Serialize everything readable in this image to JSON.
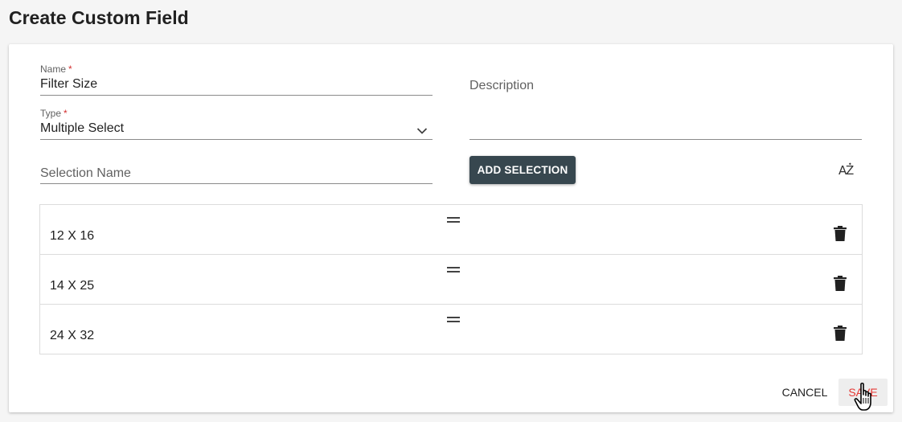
{
  "page": {
    "title": "Create Custom Field"
  },
  "form": {
    "name": {
      "label": "Name",
      "required_mark": "*",
      "value": "Filter Size"
    },
    "type": {
      "label": "Type",
      "required_mark": "*",
      "value": "Multiple Select"
    },
    "description": {
      "placeholder": "Description",
      "value": ""
    },
    "selection_name": {
      "placeholder": "Selection Name",
      "value": ""
    }
  },
  "actions": {
    "add_selection_label": "ADD SELECTION",
    "sort_icon": "sort-alphabetical-icon",
    "cancel_label": "CANCEL",
    "save_label": "SAVE"
  },
  "selections": [
    {
      "label": "12 X 16"
    },
    {
      "label": "14 X 25"
    },
    {
      "label": "24 X 32"
    }
  ],
  "icons": {
    "drag": "drag-handle-icon",
    "delete": "trash-icon",
    "dropdown": "chevron-down-icon",
    "cursor": "hand-pointer-icon"
  },
  "colors": {
    "primary_button": "#37474f",
    "save_text": "#e53935",
    "required": "#d32f2f",
    "background": "#f5f5f5"
  }
}
